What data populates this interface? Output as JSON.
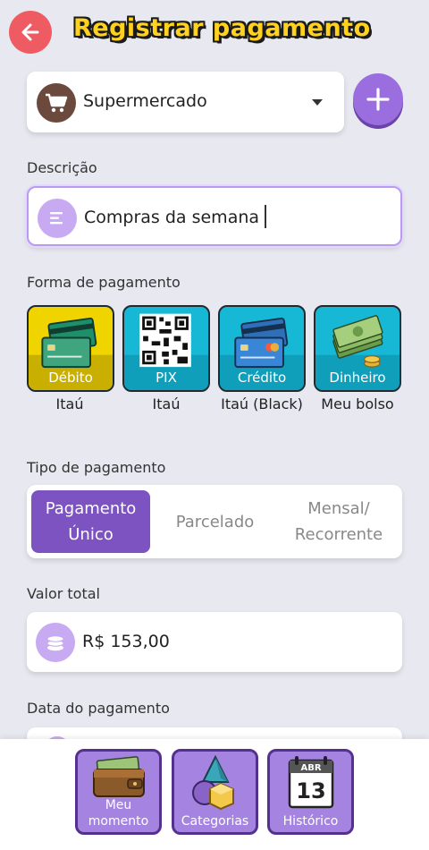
{
  "header": {
    "title": "Registrar pagamento"
  },
  "category": {
    "selected": "Supermercado"
  },
  "description": {
    "label": "Descrição",
    "value": "Compras da semana"
  },
  "payment_method": {
    "label": "Forma de pagamento",
    "options": [
      {
        "name": "Débito",
        "account": "Itaú",
        "bg": "#f0d400"
      },
      {
        "name": "PIX",
        "account": "Itaú",
        "bg": "#17b8d6"
      },
      {
        "name": "Crédito",
        "account": "Itaú (Black)",
        "bg": "#17b8d6"
      },
      {
        "name": "Dinheiro",
        "account": "Meu bolso",
        "bg": "#17b8d6"
      }
    ]
  },
  "payment_type": {
    "label": "Tipo de pagamento",
    "options": [
      "Pagamento Único",
      "Parcelado",
      "Mensal/ Recorrente"
    ],
    "selected": "Pagamento Único"
  },
  "total": {
    "label": "Valor total",
    "value": "R$ 153,00"
  },
  "date": {
    "label": "Data do pagamento"
  },
  "bottom_nav": [
    {
      "label": "Meu momento"
    },
    {
      "label": "Categorias"
    },
    {
      "label": "Histórico",
      "calendar_month": "ABR",
      "calendar_day": "13"
    }
  ],
  "colors": {
    "accent": "#7d52c1",
    "back": "#ef5b62",
    "title": "#ffd21f"
  }
}
